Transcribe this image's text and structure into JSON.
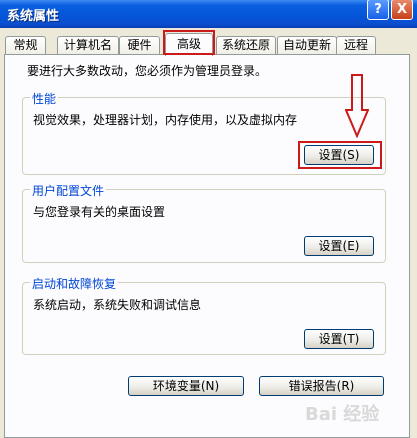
{
  "window": {
    "title": "系统属性",
    "help_label": "?",
    "close_label": "X"
  },
  "tabs": [
    {
      "label": "常规"
    },
    {
      "label": "计算机名"
    },
    {
      "label": "硬件"
    },
    {
      "label": "高级",
      "active": true
    },
    {
      "label": "系统还原"
    },
    {
      "label": "自动更新"
    },
    {
      "label": "远程"
    }
  ],
  "notice": "要进行大多数改动，您必须作为管理员登录。",
  "groups": {
    "performance": {
      "title": "性能",
      "description": "视觉效果，处理器计划，内存使用，以及虚拟内存",
      "button": "设置(S)"
    },
    "user_profiles": {
      "title": "用户配置文件",
      "description": "与您登录有关的桌面设置",
      "button": "设置(E)"
    },
    "startup_recovery": {
      "title": "启动和故障恢复",
      "description": "系统启动，系统失败和调试信息",
      "button": "设置(T)"
    }
  },
  "buttons": {
    "env_vars": "环境变量(N)",
    "error_report": "错误报告(R)"
  },
  "watermark": "Bai 经验",
  "annotation_color": "#cc1a1a"
}
